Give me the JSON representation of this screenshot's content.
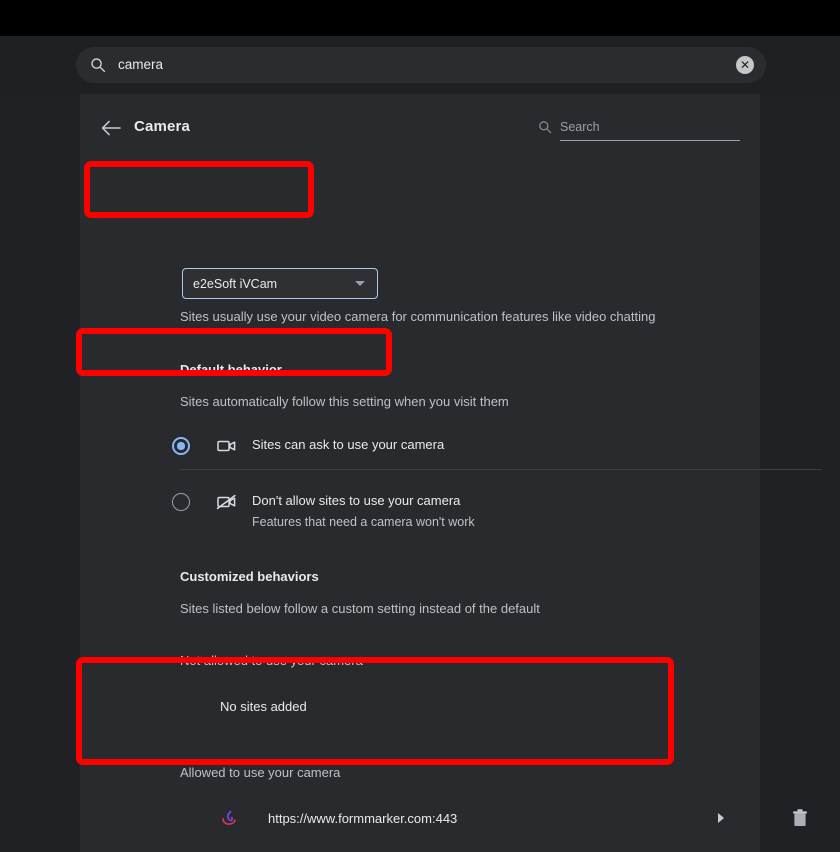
{
  "global_search": {
    "value": "camera",
    "icon": "search-icon",
    "clear_icon": "clear-icon",
    "clear_label": "✕"
  },
  "header": {
    "back_icon": "back-arrow-icon",
    "title": "Camera",
    "search_icon": "search-icon",
    "search_placeholder": "Search"
  },
  "device": {
    "selected": "e2eSoft iVCam",
    "hint": "Sites usually use your video camera for communication features like video chatting"
  },
  "default_behavior": {
    "title": "Default behavior",
    "description": "Sites automatically follow this setting when you visit them",
    "options": [
      {
        "label": "Sites can ask to use your camera",
        "sublabel": "",
        "selected": true,
        "icon": "camera-icon"
      },
      {
        "label": "Don't allow sites to use your camera",
        "sublabel": "Features that need a camera won't work",
        "selected": false,
        "icon": "camera-off-icon"
      }
    ]
  },
  "customized_behaviors": {
    "title": "Customized behaviors",
    "description": "Sites listed below follow a custom setting instead of the default",
    "blocked": {
      "label": "Not allowed to use your camera",
      "empty_text": "No sites added"
    },
    "allowed": {
      "label": "Allowed to use your camera",
      "sites": [
        {
          "url": "https://www.formmarker.com:443",
          "favicon": "formmarker-favicon",
          "chevron": "chevron-right-icon",
          "delete_icon": "trash-icon"
        }
      ]
    }
  },
  "annotations": {
    "highlight_color": "#fe0000",
    "boxes": [
      "device-dropdown-highlight",
      "ask-radio-highlight",
      "allowed-list-highlight"
    ]
  },
  "colors": {
    "accent": "#8ab4f8",
    "panel": "#292a2d",
    "background": "#202124",
    "text": "#e8eaed",
    "muted": "#bdc1c6"
  }
}
